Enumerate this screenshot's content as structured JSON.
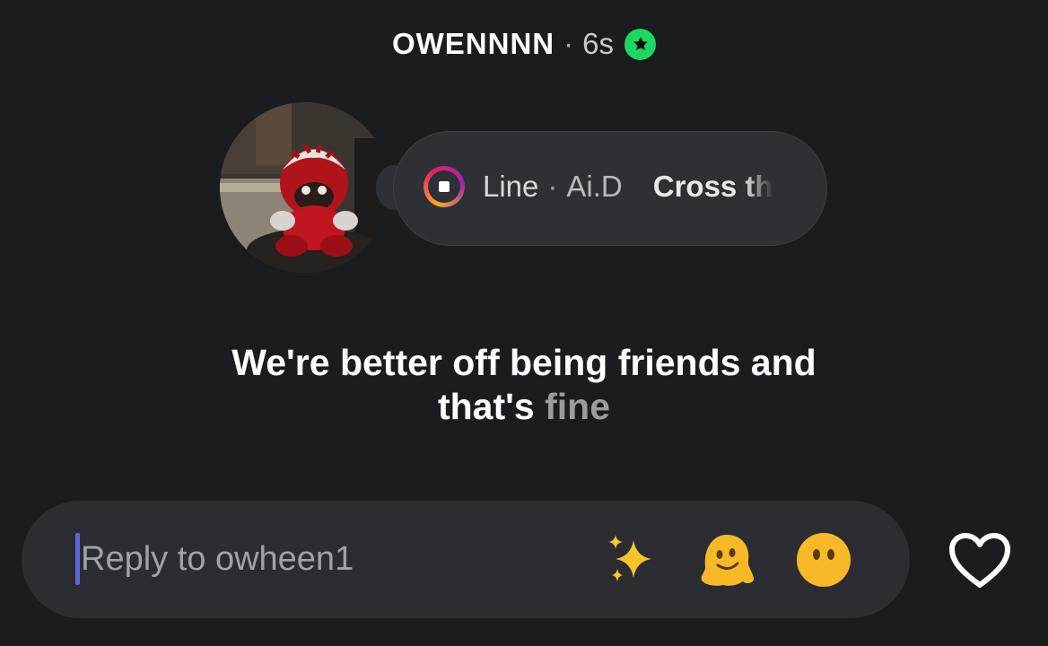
{
  "header": {
    "username": "OWENNNN",
    "separator": "·",
    "time": "6s",
    "badge_icon": "star-badge-icon",
    "badge_color": "#1ed760"
  },
  "note": {
    "song": "Line",
    "separator": "·",
    "artist": "Ai.D",
    "lyric_preview": "Cross th",
    "icon": "music-note-icon"
  },
  "lyric": {
    "line1": "We're better off being friends and",
    "line2_main": "that's",
    "line2_dim": "fine"
  },
  "reply": {
    "placeholder": "Reply to owheen1",
    "emojis": [
      "sparkles-icon",
      "melting-face-icon",
      "face-without-mouth-icon"
    ],
    "like_icon": "heart-icon"
  }
}
